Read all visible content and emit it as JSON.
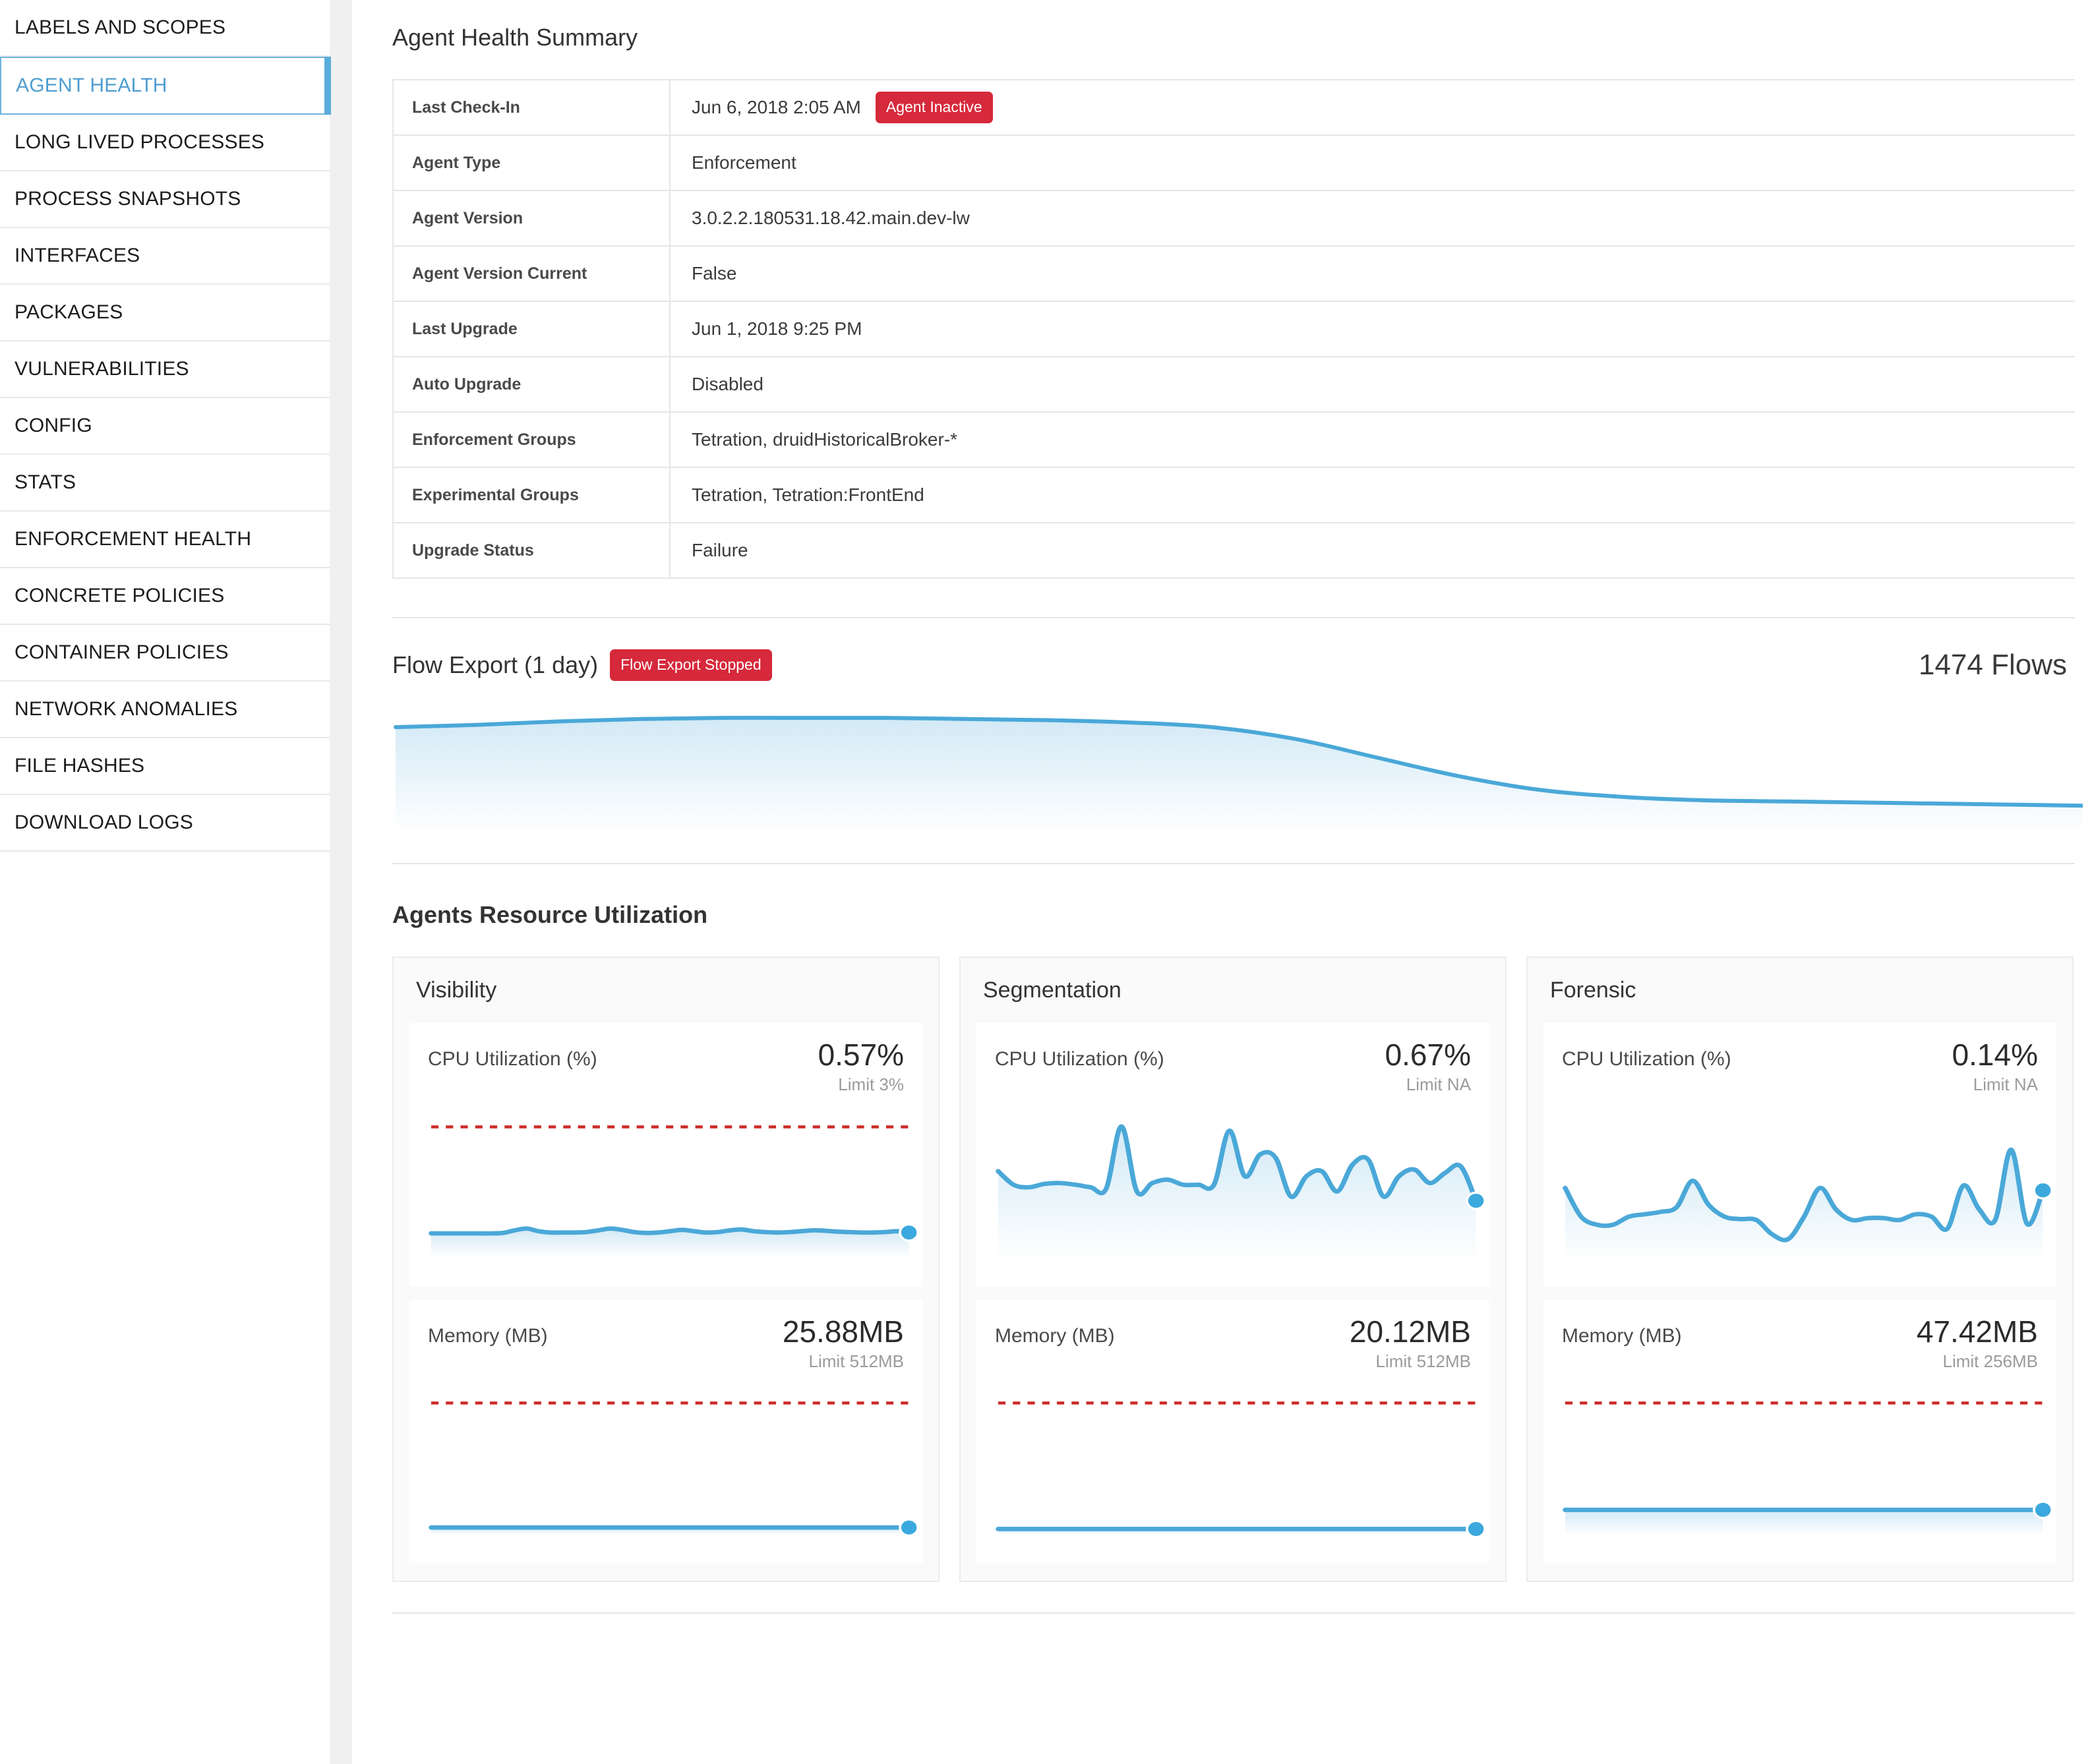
{
  "sidebar": {
    "items": [
      {
        "label": "LABELS AND SCOPES",
        "active": false
      },
      {
        "label": "AGENT HEALTH",
        "active": true
      },
      {
        "label": "LONG LIVED PROCESSES",
        "active": false
      },
      {
        "label": "PROCESS SNAPSHOTS",
        "active": false
      },
      {
        "label": "INTERFACES",
        "active": false
      },
      {
        "label": "PACKAGES",
        "active": false
      },
      {
        "label": "VULNERABILITIES",
        "active": false
      },
      {
        "label": "CONFIG",
        "active": false
      },
      {
        "label": "STATS",
        "active": false
      },
      {
        "label": "ENFORCEMENT HEALTH",
        "active": false
      },
      {
        "label": "CONCRETE POLICIES",
        "active": false
      },
      {
        "label": "CONTAINER POLICIES",
        "active": false
      },
      {
        "label": "NETWORK ANOMALIES",
        "active": false
      },
      {
        "label": "FILE HASHES",
        "active": false
      },
      {
        "label": "DOWNLOAD LOGS",
        "active": false
      }
    ]
  },
  "summary": {
    "title": "Agent Health Summary",
    "rows": [
      {
        "label": "Last Check-In",
        "value": "Jun 6, 2018 2:05 AM",
        "badge": "Agent Inactive"
      },
      {
        "label": "Agent Type",
        "value": "Enforcement",
        "badge": ""
      },
      {
        "label": "Agent Version",
        "value": "3.0.2.2.180531.18.42.main.dev-lw",
        "badge": ""
      },
      {
        "label": "Agent Version Current",
        "value": "False",
        "badge": ""
      },
      {
        "label": "Last Upgrade",
        "value": "Jun 1, 2018 9:25 PM",
        "badge": ""
      },
      {
        "label": "Auto Upgrade",
        "value": "Disabled",
        "badge": ""
      },
      {
        "label": "Enforcement Groups",
        "value": "Tetration, druidHistoricalBroker-*",
        "badge": ""
      },
      {
        "label": "Experimental Groups",
        "value": "Tetration, Tetration:FrontEnd",
        "badge": ""
      },
      {
        "label": "Upgrade Status",
        "value": "Failure",
        "badge": ""
      }
    ]
  },
  "flow_export": {
    "title": "Flow Export (1 day)",
    "badge": "Flow Export Stopped",
    "count": "1474 Flows"
  },
  "resource": {
    "title": "Agents Resource Utilization",
    "cards": [
      {
        "name": "Visibility",
        "metrics": [
          {
            "label": "CPU Utilization (%)",
            "value": "0.57%",
            "limit": "Limit 3%"
          },
          {
            "label": "Memory (MB)",
            "value": "25.88MB",
            "limit": "Limit 512MB"
          }
        ]
      },
      {
        "name": "Segmentation",
        "metrics": [
          {
            "label": "CPU Utilization (%)",
            "value": "0.67%",
            "limit": "Limit NA"
          },
          {
            "label": "Memory (MB)",
            "value": "20.12MB",
            "limit": "Limit 512MB"
          }
        ]
      },
      {
        "name": "Forensic",
        "metrics": [
          {
            "label": "CPU Utilization (%)",
            "value": "0.14%",
            "limit": "Limit NA"
          },
          {
            "label": "Memory (MB)",
            "value": "47.42MB",
            "limit": "Limit 256MB"
          }
        ]
      }
    ]
  },
  "colors": {
    "accent_blue": "#3ba9dd",
    "line_blue": "#4aa8d8",
    "fill_blue": "#bfe0f2",
    "danger_red": "#d6293b",
    "limit_line_red": "#cc2b27",
    "active_nav": "#4f9dd0"
  },
  "chart_data": [
    {
      "id": "flow-export-sparkline",
      "type": "area",
      "title": "Flow Export (1 day)",
      "xlabel": "",
      "ylabel": "Flows",
      "grid": false,
      "legend": false,
      "ylim": [
        0,
        1
      ],
      "x": [
        0,
        0.04,
        0.09,
        0.14,
        0.19,
        0.24,
        0.29,
        0.33,
        0.38,
        0.43,
        0.48,
        0.52,
        0.57,
        0.62,
        0.67,
        0.71,
        0.76,
        0.81,
        0.86,
        0.9,
        0.95,
        1.0
      ],
      "values": [
        0.88,
        0.9,
        0.93,
        0.95,
        0.96,
        0.96,
        0.96,
        0.95,
        0.94,
        0.92,
        0.88,
        0.78,
        0.62,
        0.46,
        0.34,
        0.28,
        0.25,
        0.24,
        0.23,
        0.22,
        0.21,
        0.2
      ]
    },
    {
      "id": "visibility-cpu-sparkline",
      "type": "area",
      "title": "CPU Utilization (%)",
      "limit_line": 3,
      "current": 0.57,
      "ylim": [
        0,
        3.3
      ],
      "values": [
        0.55,
        0.55,
        0.55,
        0.55,
        0.55,
        0.55,
        0.56,
        0.62,
        0.66,
        0.6,
        0.57,
        0.57,
        0.57,
        0.58,
        0.62,
        0.66,
        0.63,
        0.58,
        0.56,
        0.57,
        0.6,
        0.63,
        0.6,
        0.57,
        0.58,
        0.62,
        0.64,
        0.6,
        0.58,
        0.57,
        0.58,
        0.6,
        0.62,
        0.61,
        0.59,
        0.58,
        0.57,
        0.57,
        0.58,
        0.6,
        0.57
      ]
    },
    {
      "id": "visibility-memory-sparkline",
      "type": "area",
      "title": "Memory (MB)",
      "limit_line": 512,
      "current": 25.88,
      "ylim": [
        0,
        560
      ],
      "values": [
        25.8,
        25.8,
        25.8,
        25.9,
        25.9,
        25.8,
        25.9,
        25.9,
        25.9,
        25.88,
        25.88,
        25.88,
        25.88,
        25.9,
        25.88,
        25.88,
        25.9,
        25.88,
        25.88,
        25.88
      ]
    },
    {
      "id": "segmentation-cpu-sparkline",
      "type": "area",
      "title": "CPU Utilization (%)",
      "limit_line": null,
      "current": 0.67,
      "ylim": [
        0,
        1.7
      ],
      "values": [
        1.02,
        0.86,
        0.83,
        0.87,
        0.88,
        0.86,
        0.83,
        0.81,
        1.55,
        0.78,
        0.88,
        0.92,
        0.86,
        0.86,
        0.86,
        1.5,
        0.96,
        1.22,
        1.18,
        0.72,
        0.96,
        1.02,
        0.78,
        1.1,
        1.16,
        0.72,
        0.96,
        1.04,
        0.88,
        1.0,
        1.08,
        0.67
      ]
    },
    {
      "id": "segmentation-memory-sparkline",
      "type": "area",
      "title": "Memory (MB)",
      "limit_line": 512,
      "current": 20.12,
      "ylim": [
        0,
        560
      ],
      "values": [
        20.1,
        20.1,
        20.12,
        20.12,
        20.12,
        20.12,
        20.12,
        20.12,
        20.12,
        20.12,
        20.12,
        20.12,
        20.12,
        20.12,
        20.12,
        20.12,
        20.12,
        20.12,
        20.12,
        20.12
      ]
    },
    {
      "id": "forensic-cpu-sparkline",
      "type": "area",
      "title": "CPU Utilization (%)",
      "limit_line": null,
      "current": 0.14,
      "ylim": [
        0,
        0.3
      ],
      "values": [
        0.145,
        0.085,
        0.068,
        0.068,
        0.085,
        0.09,
        0.095,
        0.105,
        0.16,
        0.11,
        0.085,
        0.08,
        0.078,
        0.048,
        0.038,
        0.085,
        0.145,
        0.1,
        0.078,
        0.082,
        0.082,
        0.078,
        0.09,
        0.085,
        0.06,
        0.15,
        0.1,
        0.078,
        0.225,
        0.07,
        0.14
      ]
    },
    {
      "id": "forensic-memory-sparkline",
      "type": "area",
      "title": "Memory (MB)",
      "limit_line": 256,
      "current": 47.42,
      "ylim": [
        0,
        280
      ],
      "values": [
        47.4,
        47.4,
        47.42,
        47.42,
        47.42,
        47.42,
        47.42,
        47.42,
        47.42,
        47.42,
        47.42,
        47.42,
        47.42,
        47.42,
        47.42,
        47.42,
        47.42,
        47.42,
        47.42,
        47.42
      ]
    }
  ]
}
